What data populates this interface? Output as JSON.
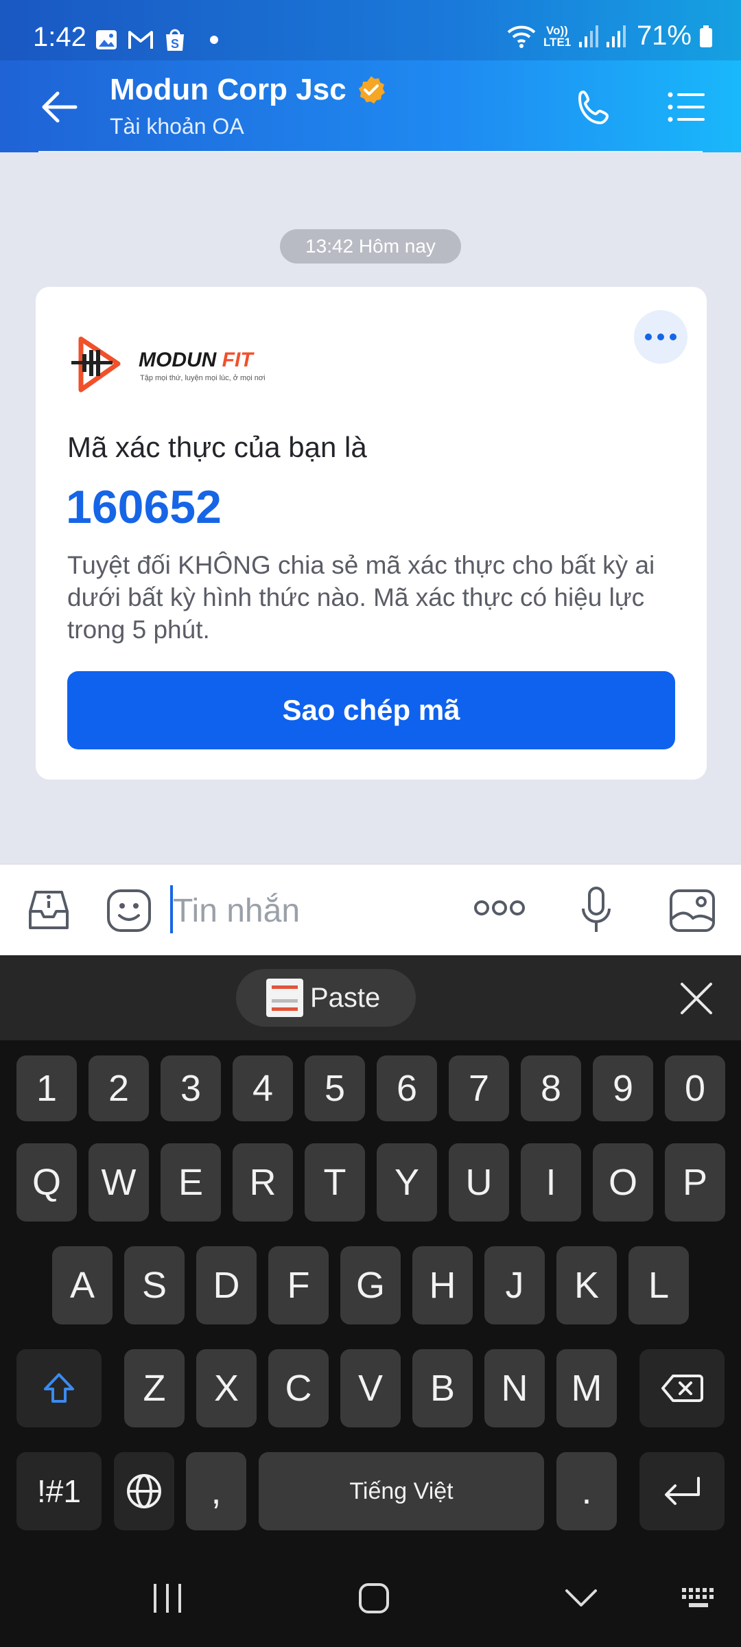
{
  "status_bar": {
    "time": "1:42",
    "lte": "Vo)) LTE1",
    "battery": "71%"
  },
  "header": {
    "title": "Modun Corp Jsc",
    "subtitle": "Tài khoản OA"
  },
  "chat": {
    "timestamp": "13:42 Hôm nay",
    "card": {
      "logo_brand": "MODUN FIT",
      "logo_tagline": "Tập mọi thứ, luyện mọi lúc, ở mọi nơi",
      "heading": "Mã xác thực của bạn là",
      "code": "160652",
      "description": "Tuyệt đối KHÔNG chia sẻ mã xác thực cho bất kỳ ai dưới bất kỳ hình thức nào. Mã xác thực có hiệu lực trong 5 phút.",
      "button_label": "Sao chép mã"
    }
  },
  "input_bar": {
    "placeholder": "Tin nhắn"
  },
  "keyboard": {
    "suggestion_label": "Paste",
    "number_row": [
      "1",
      "2",
      "3",
      "4",
      "5",
      "6",
      "7",
      "8",
      "9",
      "0"
    ],
    "row1": [
      "Q",
      "W",
      "E",
      "R",
      "T",
      "Y",
      "U",
      "I",
      "O",
      "P"
    ],
    "row2": [
      "A",
      "S",
      "D",
      "F",
      "G",
      "H",
      "J",
      "K",
      "L"
    ],
    "row3": [
      "Z",
      "X",
      "C",
      "V",
      "B",
      "N",
      "M"
    ],
    "symbols_key": "!#1",
    "comma_key": ",",
    "space_label": "Tiếng Việt",
    "period_key": "."
  },
  "colors": {
    "header_gradient_start": "#1f63d6",
    "header_gradient_end": "#19b8fb",
    "accent": "#1665e6",
    "button": "#0f62ee",
    "verified_badge": "#f5a623",
    "keyboard_bg": "#121212",
    "key_bg": "#3a3a3a"
  }
}
